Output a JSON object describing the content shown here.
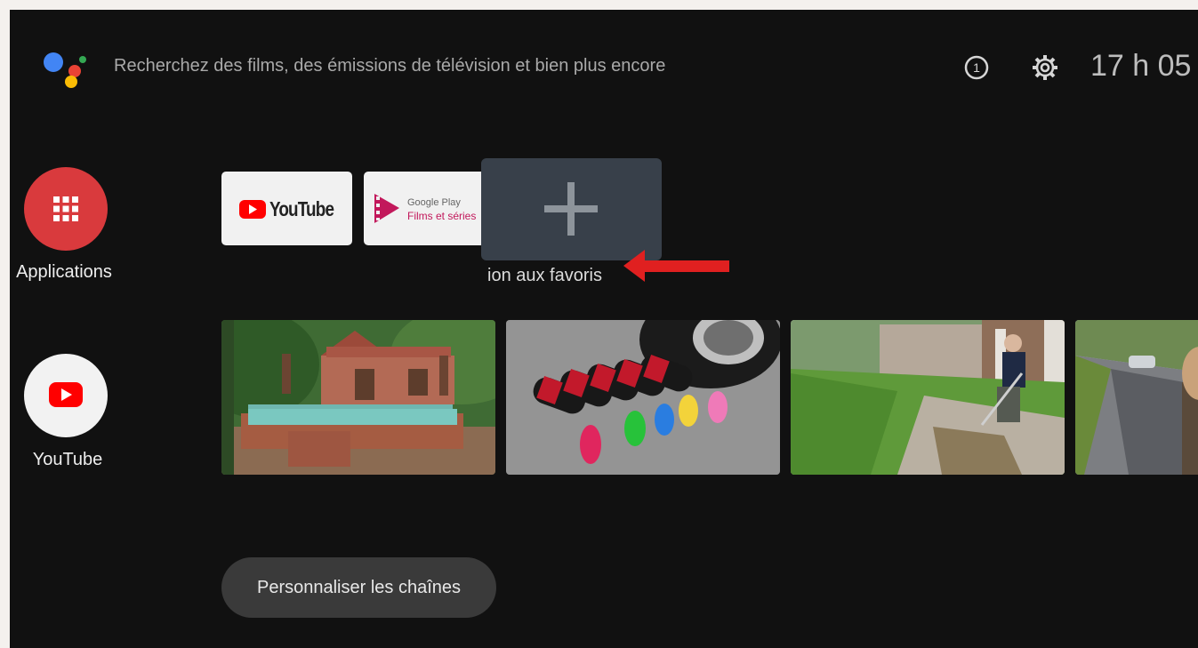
{
  "search": {
    "placeholder": "Recherchez des films, des émissions de télévision et bien plus encore"
  },
  "status": {
    "clock": "17 h 05"
  },
  "rail": {
    "apps_label": "Applications",
    "youtube_label": "YouTube"
  },
  "favorites": {
    "youtube_tile": {
      "wordmark": "YouTube"
    },
    "play_tile": {
      "line1": "Google Play",
      "line2": "Films et séries"
    },
    "add_caption": "ion aux favoris"
  },
  "footer": {
    "customize_label": "Personnaliser les chaînes"
  },
  "colors": {
    "apps_red": "#d93a3d",
    "youtube_red": "#ff0000",
    "arrow_red": "#e02020",
    "play_magenta": "#c2185b",
    "add_tile_bg": "#38404a"
  },
  "icons": [
    "google-assistant-icon",
    "info-icon",
    "gear-icon",
    "grid-apps-icon",
    "youtube-play-icon",
    "plus-icon",
    "arrow-left-icon"
  ]
}
